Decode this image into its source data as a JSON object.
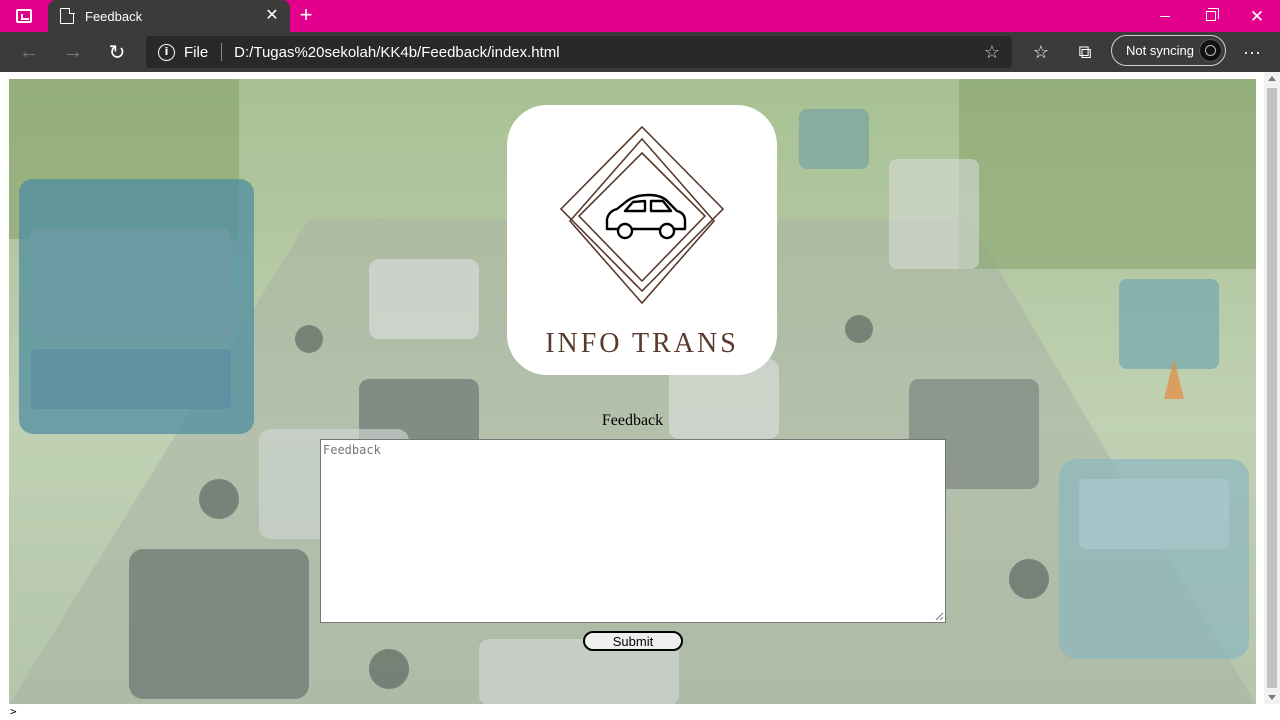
{
  "browser": {
    "tab_actions_icon": "tab-actions-icon",
    "tab": {
      "title": "Feedback",
      "favicon": "page-icon",
      "close_glyph": "✕"
    },
    "new_tab_glyph": "+",
    "window_controls": {
      "minimize_icon": "minimize-icon",
      "restore_icon": "restore-icon",
      "close_glyph": "✕"
    },
    "toolbar": {
      "back_glyph": "←",
      "forward_glyph": "→",
      "refresh_glyph": "↻",
      "site_info_glyph": "i",
      "site_label": "File",
      "url": "D:/Tugas%20sekolah/KK4b/Feedback/index.html",
      "add_favorite_glyph": "☆",
      "favorites_glyph": "☆",
      "collections_glyph": "⧉",
      "sync_label": "Not syncing",
      "more_glyph": "···"
    },
    "accent_color": "#e3008c",
    "toolbar_color": "#3b3b3b"
  },
  "page": {
    "logo_text": "INFO TRANS",
    "logo_color": "#5b3a2e",
    "heading": "Feedback",
    "textarea_placeholder": "Feedback",
    "submit_label": "Submit"
  },
  "statusbar": {
    "text": ">"
  }
}
